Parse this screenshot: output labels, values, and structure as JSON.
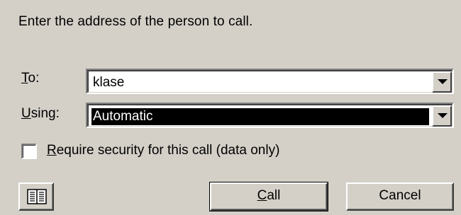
{
  "instruction": "Enter the address of the person to call.",
  "to_field": {
    "label_mnemonic": "T",
    "label_rest": "o:",
    "value": "klase"
  },
  "using_field": {
    "label_mnemonic": "U",
    "label_rest": "sing:",
    "value": "Automatic"
  },
  "security_checkbox": {
    "label_mnemonic": "R",
    "label_rest": "equire security for this call (data only)",
    "checked": false
  },
  "buttons": {
    "address_book_icon": "address-book-icon",
    "call_mnemonic": "C",
    "call_rest": "all",
    "cancel": "Cancel"
  },
  "colors": {
    "dialog_bg": "#d4d0c8",
    "selection_bg": "#000000",
    "selection_fg": "#ffffff"
  }
}
